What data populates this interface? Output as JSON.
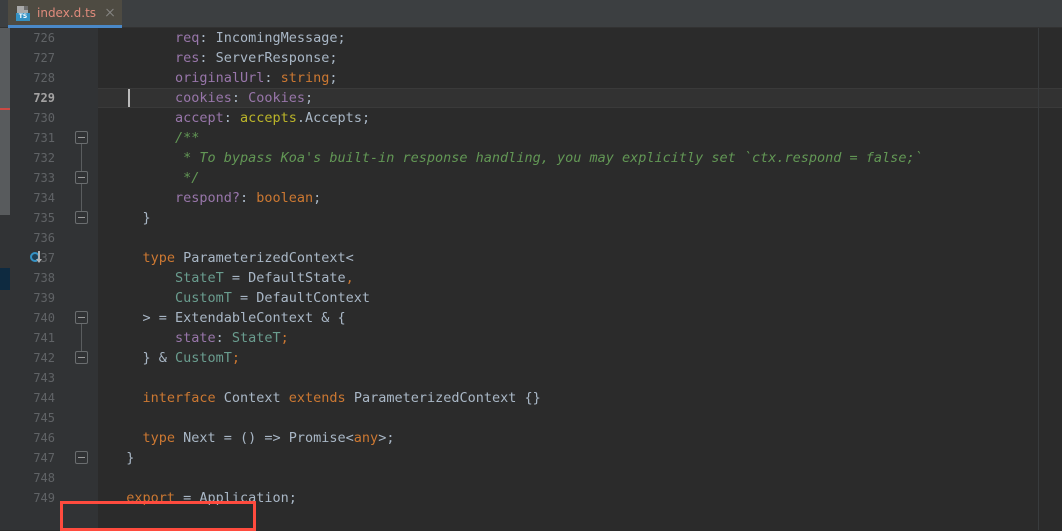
{
  "tab": {
    "filename": "index.d.ts",
    "icon": "typescript-declaration-file-icon",
    "badge": "TS",
    "close_label": "close-tab",
    "active_accent": "#4a88c7",
    "label_color": "#e08b7c"
  },
  "editor": {
    "theme": "darcula",
    "background": "#2b2b2b",
    "gutter_background": "#313335",
    "current_line": 729,
    "caret_line": 729,
    "caret_column": 9,
    "first_visible_line": 726,
    "last_visible_line": 749,
    "right_margin_column_guide": true,
    "gutter_markers": [
      {
        "line": 737,
        "icon": "implemented-member-icon"
      }
    ],
    "fold_markers": [
      {
        "line": 731,
        "state": "expanded"
      },
      {
        "line": 733,
        "state": "expanded"
      },
      {
        "line": 735,
        "state": "expanded"
      },
      {
        "line": 740,
        "state": "expanded"
      },
      {
        "line": 742,
        "state": "expanded"
      },
      {
        "line": 747,
        "state": "expanded"
      }
    ],
    "vcs_strip": {
      "scrollbar_thumb": true,
      "modified_marker_line": 730,
      "highlight_marker_line": 738
    },
    "annotation_box": {
      "color": "#ff4b3e",
      "target_line": 749,
      "target_text": "export = Application;"
    },
    "lines": [
      {
        "num": 726,
        "indent": 8,
        "segments": [
          {
            "t": "req",
            "c": "prop"
          },
          {
            "t": ": ",
            "c": "punc"
          },
          {
            "t": "IncomingMessage",
            "c": "typ"
          },
          {
            "t": ";",
            "c": "punc"
          }
        ]
      },
      {
        "num": 727,
        "indent": 8,
        "segments": [
          {
            "t": "res",
            "c": "prop"
          },
          {
            "t": ": ",
            "c": "punc"
          },
          {
            "t": "ServerResponse",
            "c": "typ"
          },
          {
            "t": ";",
            "c": "punc"
          }
        ]
      },
      {
        "num": 728,
        "indent": 8,
        "segments": [
          {
            "t": "originalUrl",
            "c": "prop"
          },
          {
            "t": ": ",
            "c": "punc"
          },
          {
            "t": "string",
            "c": "kw"
          },
          {
            "t": ";",
            "c": "punc"
          }
        ]
      },
      {
        "num": 729,
        "indent": 8,
        "segments": [
          {
            "t": "cookies",
            "c": "prop"
          },
          {
            "t": ": ",
            "c": "punc"
          },
          {
            "t": "Cookies",
            "c": "prop"
          },
          {
            "t": ";",
            "c": "punc"
          }
        ]
      },
      {
        "num": 730,
        "indent": 8,
        "segments": [
          {
            "t": "accept",
            "c": "prop"
          },
          {
            "t": ": ",
            "c": "punc"
          },
          {
            "t": "accepts",
            "c": "obj"
          },
          {
            "t": ".",
            "c": "punc"
          },
          {
            "t": "Accepts",
            "c": "typ"
          },
          {
            "t": ";",
            "c": "punc"
          }
        ]
      },
      {
        "num": 731,
        "indent": 8,
        "segments": [
          {
            "t": "/**",
            "c": "cmt"
          }
        ]
      },
      {
        "num": 732,
        "indent": 9,
        "segments": [
          {
            "t": "* To bypass Koa's built-in response handling, you may explicitly set `ctx.respond = false;`",
            "c": "cmt"
          }
        ]
      },
      {
        "num": 733,
        "indent": 9,
        "segments": [
          {
            "t": "*/",
            "c": "cmt"
          }
        ]
      },
      {
        "num": 734,
        "indent": 8,
        "segments": [
          {
            "t": "respond?",
            "c": "prop"
          },
          {
            "t": ": ",
            "c": "punc"
          },
          {
            "t": "boolean",
            "c": "kw"
          },
          {
            "t": ";",
            "c": "punc"
          }
        ]
      },
      {
        "num": 735,
        "indent": 4,
        "segments": [
          {
            "t": "}",
            "c": "punc"
          }
        ]
      },
      {
        "num": 736,
        "indent": 0,
        "segments": []
      },
      {
        "num": 737,
        "indent": 4,
        "segments": [
          {
            "t": "type",
            "c": "kw"
          },
          {
            "t": " ParameterizedContext<",
            "c": "typ"
          }
        ]
      },
      {
        "num": 738,
        "indent": 8,
        "segments": [
          {
            "t": "StateT",
            "c": "gen"
          },
          {
            "t": " = DefaultState",
            "c": "typ"
          },
          {
            "t": ",",
            "c": "kw"
          }
        ]
      },
      {
        "num": 739,
        "indent": 8,
        "segments": [
          {
            "t": "CustomT",
            "c": "gen"
          },
          {
            "t": " = DefaultContext",
            "c": "typ"
          }
        ]
      },
      {
        "num": 740,
        "indent": 4,
        "segments": [
          {
            "t": "> = ExtendableContext & {",
            "c": "typ"
          }
        ]
      },
      {
        "num": 741,
        "indent": 8,
        "segments": [
          {
            "t": "state",
            "c": "prop"
          },
          {
            "t": ": ",
            "c": "punc"
          },
          {
            "t": "StateT",
            "c": "gen"
          },
          {
            "t": ";",
            "c": "kw"
          }
        ]
      },
      {
        "num": 742,
        "indent": 4,
        "segments": [
          {
            "t": "} & ",
            "c": "typ"
          },
          {
            "t": "CustomT",
            "c": "gen"
          },
          {
            "t": ";",
            "c": "kw"
          }
        ]
      },
      {
        "num": 743,
        "indent": 0,
        "segments": []
      },
      {
        "num": 744,
        "indent": 4,
        "segments": [
          {
            "t": "interface",
            "c": "kw"
          },
          {
            "t": " Context ",
            "c": "typ"
          },
          {
            "t": "extends",
            "c": "kw"
          },
          {
            "t": " ParameterizedContext {}",
            "c": "typ"
          }
        ]
      },
      {
        "num": 745,
        "indent": 0,
        "segments": []
      },
      {
        "num": 746,
        "indent": 4,
        "segments": [
          {
            "t": "type",
            "c": "kw"
          },
          {
            "t": " Next = () => Promise<",
            "c": "typ"
          },
          {
            "t": "any",
            "c": "kw"
          },
          {
            "t": ">;",
            "c": "typ"
          }
        ]
      },
      {
        "num": 747,
        "indent": 2,
        "segments": [
          {
            "t": "}",
            "c": "punc"
          }
        ]
      },
      {
        "num": 748,
        "indent": 0,
        "segments": []
      },
      {
        "num": 749,
        "indent": 2,
        "segments": [
          {
            "t": "export",
            "c": "kw"
          },
          {
            "t": " = Application;",
            "c": "typ"
          }
        ]
      }
    ]
  }
}
